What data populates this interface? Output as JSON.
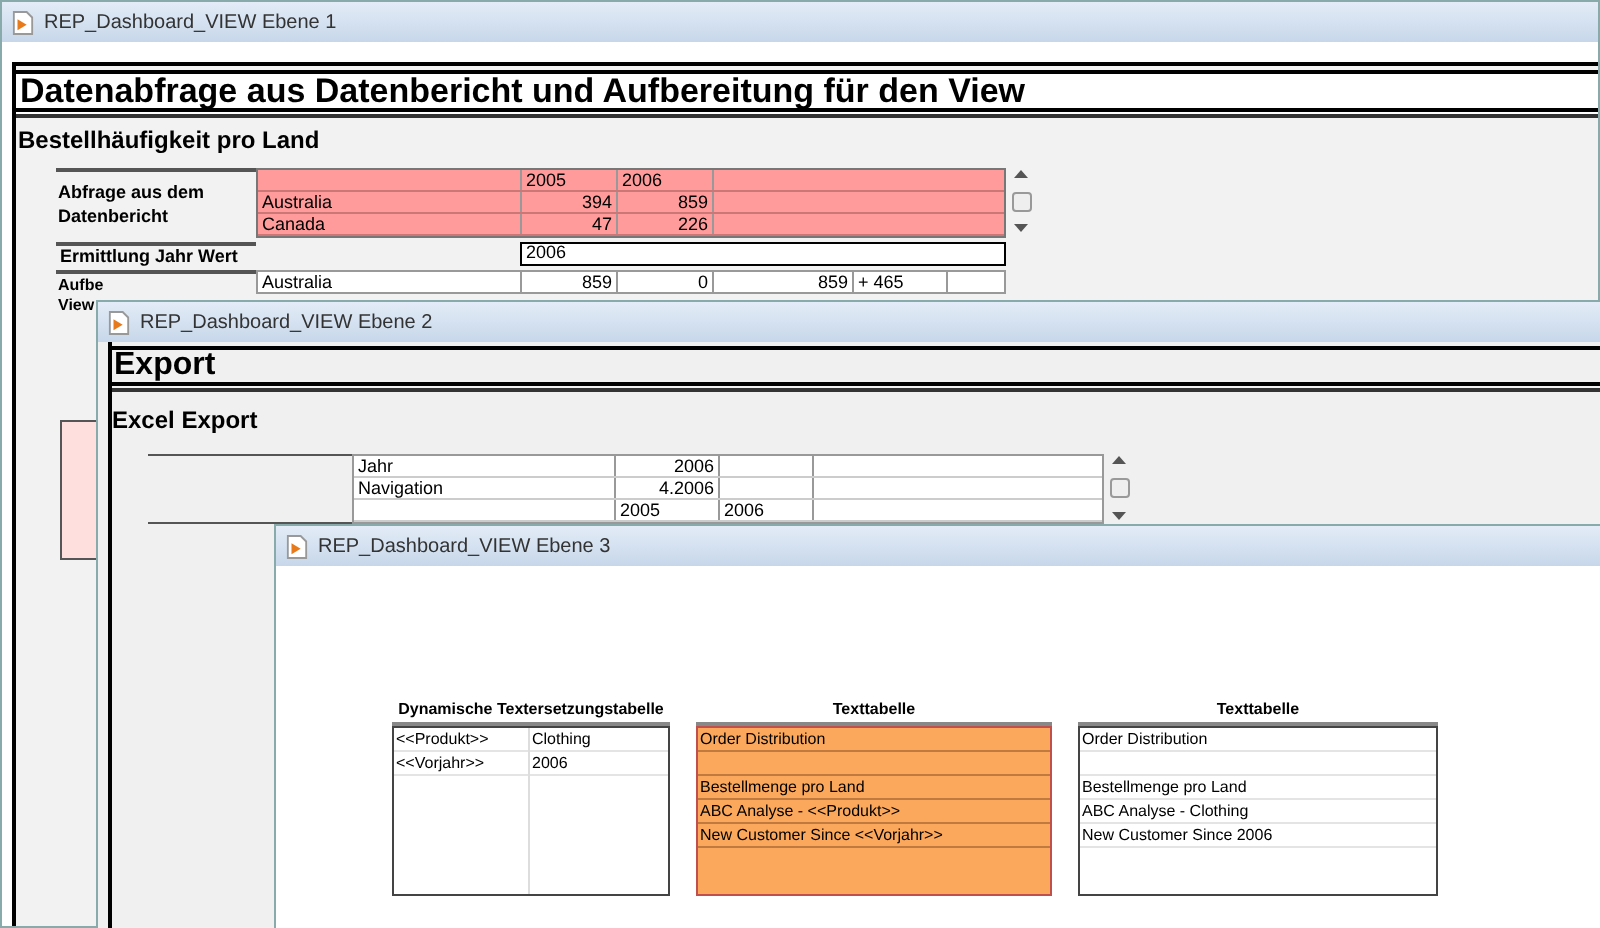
{
  "window_1": {
    "title": "REP_Dashboard_VIEW Ebene 1",
    "heading": "Datenabfrage aus Datenbericht und Aufbereitung für den View",
    "subheading": "Bestellhäufigkeit pro Land",
    "query": {
      "label": "Abfrage aus dem Datenbericht",
      "rows": [
        {
          "kind": "header",
          "cells": [
            "2005",
            "2006"
          ]
        },
        {
          "kind": "data",
          "label": "Australia",
          "cells": [
            "394",
            "859"
          ]
        },
        {
          "kind": "data",
          "label": "Canada",
          "cells": [
            "47",
            "226"
          ]
        }
      ]
    },
    "year": {
      "label": "Ermittlung Jahr Wert",
      "value": "2006"
    },
    "prepared": {
      "label_lines": [
        "Aufbe",
        "View"
      ],
      "label": "Australia",
      "cells": [
        "859",
        "0",
        "859",
        "+ 465"
      ]
    }
  },
  "window_2": {
    "title": "REP_Dashboard_VIEW Ebene 2",
    "heading": "Export",
    "subheading": "Excel Export",
    "rows": [
      {
        "kind": "data",
        "label": "Jahr",
        "cells": [
          "2006"
        ]
      },
      {
        "kind": "data",
        "label": "Navigation",
        "cells": [
          "4.2006"
        ]
      },
      {
        "kind": "header",
        "cells": [
          "2005",
          "2006"
        ]
      }
    ]
  },
  "window_3": {
    "title": "REP_Dashboard_VIEW Ebene 3",
    "tables": [
      {
        "heading": "Dynamische Textersetzungstabelle",
        "kind": "pairs",
        "highlighted": false,
        "rows": [
          [
            "<<Produkt>>",
            "Clothing"
          ],
          [
            "<<Vorjahr>>",
            "2006"
          ]
        ]
      },
      {
        "heading": "Texttabelle",
        "kind": "list",
        "highlighted": true,
        "rows": [
          {
            "kind": "text",
            "text": "Order Distribution"
          },
          {
            "kind": "spacer"
          },
          {
            "kind": "text",
            "text": "Bestellmenge pro Land"
          },
          {
            "kind": "text",
            "text": "ABC Analyse - <<Produkt>>"
          },
          {
            "kind": "text",
            "text": "New Customer Since <<Vorjahr>>"
          }
        ]
      },
      {
        "heading": "Texttabelle",
        "kind": "list",
        "highlighted": false,
        "rows": [
          {
            "kind": "text",
            "text": "Order Distribution"
          },
          {
            "kind": "spacer"
          },
          {
            "kind": "text",
            "text": "Bestellmenge pro Land"
          },
          {
            "kind": "text",
            "text": "ABC Analyse - Clothing"
          },
          {
            "kind": "text",
            "text": "New Customer Since 2006"
          }
        ]
      }
    ]
  }
}
